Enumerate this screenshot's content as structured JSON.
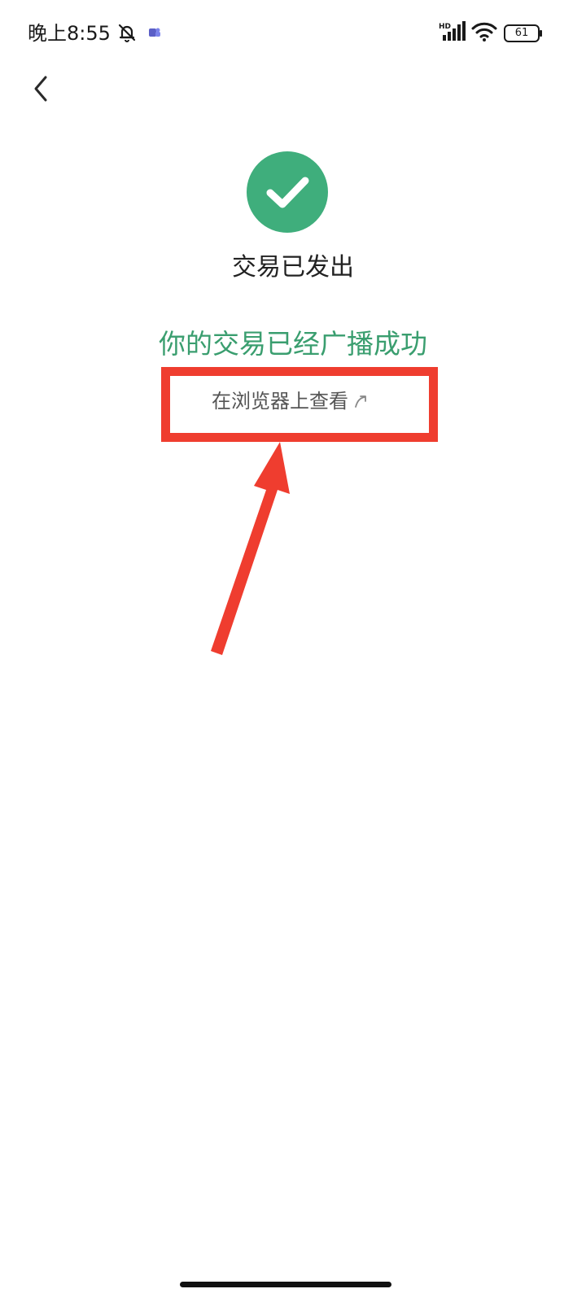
{
  "status_bar": {
    "time": "晚上8:55",
    "network_label": "HD",
    "battery_level": "61",
    "icons": [
      "alarm-off-icon",
      "app-notification-icon",
      "signal-icon",
      "wifi-icon",
      "battery-icon"
    ]
  },
  "nav": {
    "back_icon": "back-chevron-icon"
  },
  "result": {
    "icon": "checkmark-circle-icon",
    "title": "交易已发出",
    "view_link_label": "在浏览器上查看",
    "view_link_icon": "external-link-arrow-icon"
  },
  "annotation": {
    "caption": "你的交易已经广播成功",
    "highlight_color": "#ef3d2f"
  },
  "colors": {
    "success_green": "#3fae7c",
    "caption_green": "#3a9e6f",
    "annotation_red": "#ef3d2f"
  }
}
